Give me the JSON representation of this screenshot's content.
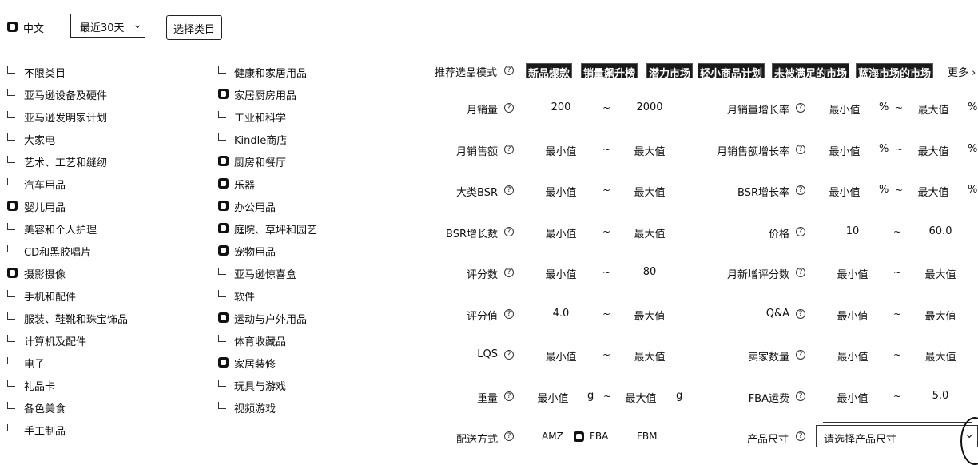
{
  "top_bar": {
    "language": "中文",
    "period": "最近30天",
    "select_category": "选择类目"
  },
  "categories_left": [
    {
      "label": "不限类目",
      "checked": false
    },
    {
      "label": "亚马逊设备及硬件",
      "checked": false
    },
    {
      "label": "亚马逊发明家计划",
      "checked": false
    },
    {
      "label": "大家电",
      "checked": false
    },
    {
      "label": "艺术、工艺和缝纫",
      "checked": false
    },
    {
      "label": "汽车用品",
      "checked": false
    },
    {
      "label": "婴儿用品",
      "checked": true
    },
    {
      "label": "美容和个人护理",
      "checked": false
    },
    {
      "label": "CD和黑胶唱片",
      "checked": false
    },
    {
      "label": "摄影摄像",
      "checked": true
    },
    {
      "label": "手机和配件",
      "checked": false
    },
    {
      "label": "服装、鞋靴和珠宝饰品",
      "checked": false
    },
    {
      "label": "计算机及配件",
      "checked": false
    },
    {
      "label": "电子",
      "checked": false
    },
    {
      "label": "礼品卡",
      "checked": false
    },
    {
      "label": "各色美食",
      "checked": false
    },
    {
      "label": "手工制品",
      "checked": false
    }
  ],
  "categories_right": [
    {
      "label": "健康和家居用品",
      "checked": false
    },
    {
      "label": "家居厨房用品",
      "checked": true
    },
    {
      "label": "工业和科学",
      "checked": false
    },
    {
      "label": "Kindle商店",
      "checked": false
    },
    {
      "label": "厨房和餐厅",
      "checked": true
    },
    {
      "label": "乐器",
      "checked": true
    },
    {
      "label": "办公用品",
      "checked": true
    },
    {
      "label": "庭院、草坪和园艺",
      "checked": true
    },
    {
      "label": "宠物用品",
      "checked": true
    },
    {
      "label": "亚马逊惊喜盒",
      "checked": false
    },
    {
      "label": "软件",
      "checked": false
    },
    {
      "label": "运动与户外用品",
      "checked": true
    },
    {
      "label": "体育收藏品",
      "checked": false
    },
    {
      "label": "家居装修",
      "checked": true
    },
    {
      "label": "玩具与游戏",
      "checked": false
    },
    {
      "label": "视频游戏",
      "checked": false
    }
  ],
  "modes": {
    "label": "推荐选品模式",
    "tags": [
      "新品爆款",
      "销量飙升榜",
      "潜力市场",
      "轻小商品计划",
      "未被满足的市场",
      "蓝海市场的市场"
    ],
    "more": "更多"
  },
  "filters": {
    "monthly_sales": {
      "label": "月销量",
      "min": "200",
      "max": "2000"
    },
    "monthly_sales_growth": {
      "label": "月销量增长率",
      "min": "最小值",
      "max": "最大值",
      "unit": "%"
    },
    "monthly_revenue": {
      "label": "月销售额",
      "min": "最小值",
      "max": "最大值"
    },
    "monthly_revenue_growth": {
      "label": "月销售额增长率",
      "min": "最小值",
      "max": "最大值",
      "unit": "%"
    },
    "category_bsr": {
      "label": "大类BSR",
      "min": "最小值",
      "max": "最大值"
    },
    "bsr_growth_rate": {
      "label": "BSR增长率",
      "min": "最小值",
      "max": "最大值",
      "unit": "%"
    },
    "bsr_growth_count": {
      "label": "BSR增长数",
      "min": "最小值",
      "max": "最大值"
    },
    "price": {
      "label": "价格",
      "min": "10",
      "max": "60.0"
    },
    "rating_count": {
      "label": "评分数",
      "min": "最小值",
      "max": "80"
    },
    "monthly_new_ratings": {
      "label": "月新增评分数",
      "min": "最小值",
      "max": "最大值"
    },
    "rating_value": {
      "label": "评分值",
      "min": "4.0",
      "max": "最大值"
    },
    "qa": {
      "label": "Q&A",
      "min": "最小值",
      "max": "最大值"
    },
    "lqs": {
      "label": "LQS",
      "min": "最小值",
      "max": "最大值"
    },
    "seller_count": {
      "label": "卖家数量",
      "min": "最小值",
      "max": "最大值"
    },
    "weight": {
      "label": "重量",
      "min": "最小值",
      "max": "最大值",
      "unit": "g"
    },
    "fba_fee": {
      "label": "FBA运费",
      "min": "最小值",
      "max": "5.0"
    }
  },
  "shipping": {
    "label": "配送方式",
    "options": [
      {
        "label": "AMZ",
        "checked": false
      },
      {
        "label": "FBA",
        "checked": true
      },
      {
        "label": "FBM",
        "checked": false
      }
    ]
  },
  "product_size": {
    "label": "产品尺寸",
    "placeholder": "请选择产品尺寸"
  },
  "tilde": "~",
  "help_symbol": "?"
}
